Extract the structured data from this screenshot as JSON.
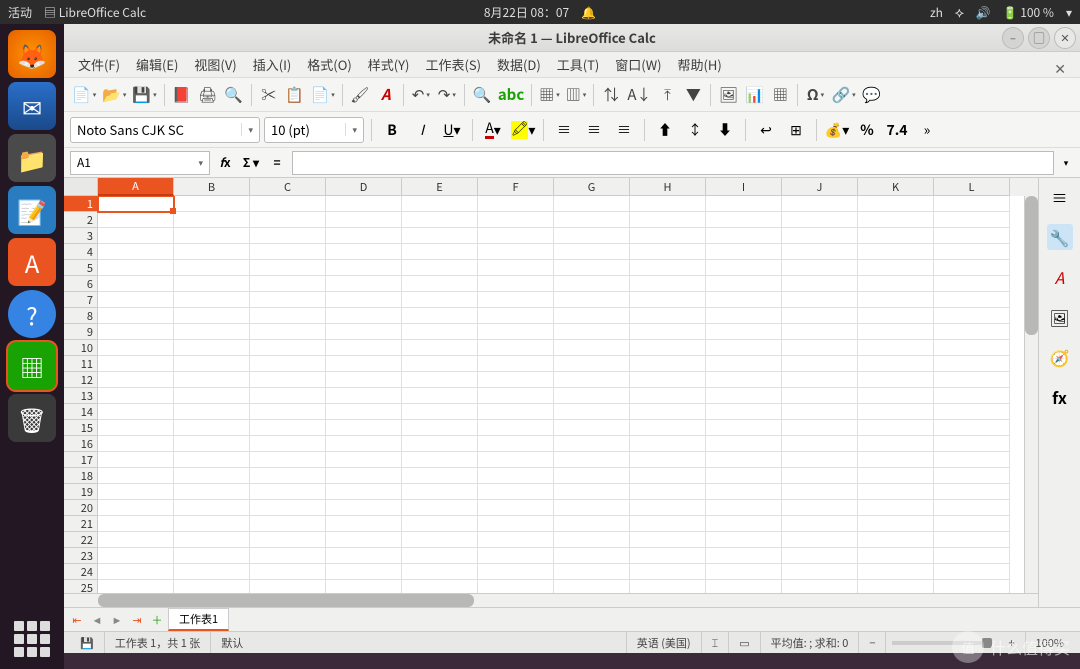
{
  "gnome": {
    "activities": "活动",
    "app_indicator": "LibreOffice Calc",
    "datetime": "8月22日 08：07",
    "ime": "zh",
    "battery": "100 %"
  },
  "window": {
    "title": "未命名 1 — LibreOffice Calc"
  },
  "menu": {
    "file": "文件(F)",
    "edit": "编辑(E)",
    "view": "视图(V)",
    "insert": "插入(I)",
    "format": "格式(O)",
    "style": "样式(Y)",
    "sheet": "工作表(S)",
    "data": "数据(D)",
    "tools": "工具(T)",
    "window": "窗口(W)",
    "help": "帮助(H)"
  },
  "format": {
    "font_name": "Noto Sans CJK SC",
    "font_size": "10 (pt)",
    "decimal_sample": "7.4"
  },
  "formula": {
    "cell_ref": "A1",
    "value": ""
  },
  "columns": [
    "A",
    "B",
    "C",
    "D",
    "E",
    "F",
    "G",
    "H",
    "I",
    "J",
    "K",
    "L"
  ],
  "rows": [
    "1",
    "2",
    "3",
    "4",
    "5",
    "6",
    "7",
    "8",
    "9",
    "10",
    "11",
    "12",
    "13",
    "14",
    "15",
    "16",
    "17",
    "18",
    "19",
    "20",
    "21",
    "22",
    "23",
    "24",
    "25"
  ],
  "selected": {
    "col": "A",
    "row": "1"
  },
  "sidebar": {
    "fx": "fx"
  },
  "tabs": {
    "sheet1": "工作表1"
  },
  "status": {
    "sheet_info": "工作表 1，共 1 张",
    "selection_mode": "默认",
    "language": "英语 (美国)",
    "stats": "平均值: ; 求和: 0",
    "zoom": "100%"
  },
  "watermark": {
    "text": "什么值得买",
    "badge": "值"
  }
}
